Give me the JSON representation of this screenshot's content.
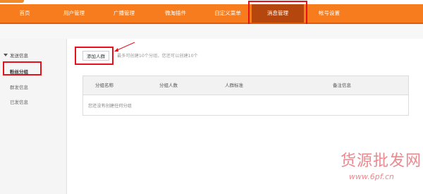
{
  "nav": {
    "items": [
      {
        "label": "首页"
      },
      {
        "label": "用户管理"
      },
      {
        "label": "广播管理"
      },
      {
        "label": "微淘插件"
      },
      {
        "label": "自定义菜单"
      },
      {
        "label": "消息管理",
        "active": true
      },
      {
        "label": "帐号设置"
      }
    ]
  },
  "sidebar": {
    "group_label": "发送信息",
    "items": [
      {
        "label": "粉丝分组",
        "selected": true
      },
      {
        "label": "群发信息"
      },
      {
        "label": "已发信息"
      }
    ]
  },
  "main": {
    "add_button": "添加人群",
    "hint": "最多可创建10个分组，您还可以创建10个",
    "table": {
      "columns": [
        "分组名称",
        "分组人数",
        "人群标准",
        "备注信息"
      ],
      "empty_text": "您还没有创建任何分组"
    }
  },
  "watermark": {
    "chinese": "货源批发网",
    "url": "www.6pf.cn"
  },
  "colors": {
    "nav_bg": "#f67c1d",
    "nav_active": "#b4460e",
    "highlight": "#e6121a"
  }
}
